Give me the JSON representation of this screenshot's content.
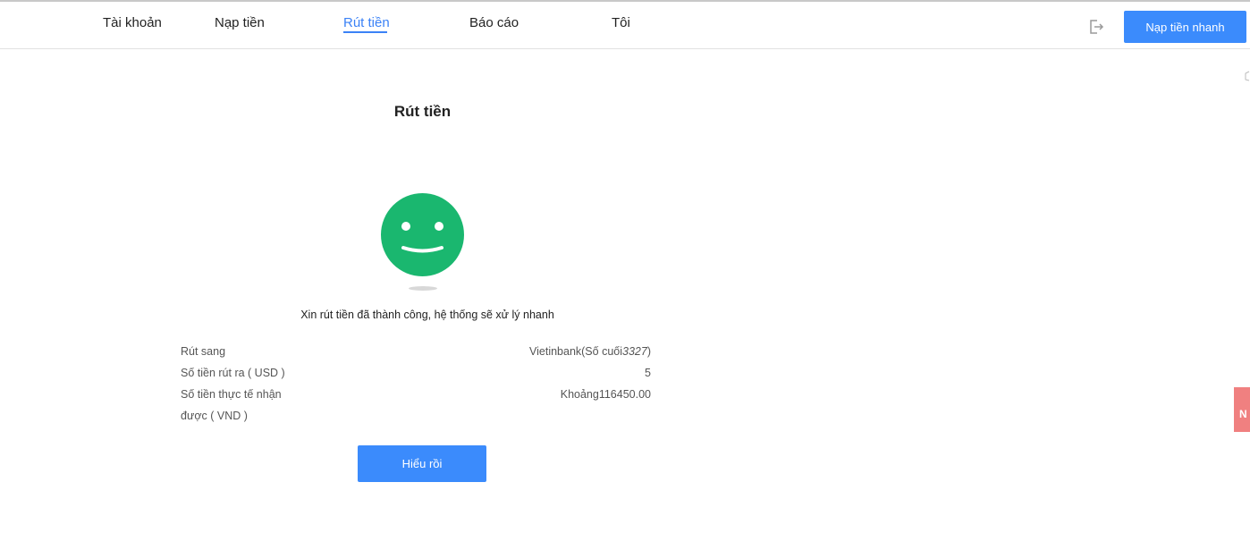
{
  "nav": {
    "items": [
      {
        "label": "Tài khoản"
      },
      {
        "label": "Nạp tiền"
      },
      {
        "label": "Rút tiền",
        "active": true
      },
      {
        "label": "Báo cáo"
      },
      {
        "label": "Tôi"
      }
    ],
    "logout_icon": "logout-icon",
    "quick_deposit_label": "Nạp tiền nhanh"
  },
  "page": {
    "title": "Rút tiền",
    "status_icon": "smiley-face-icon",
    "success_message": "Xin rút tiền đã thành công, hệ thống sẽ xử lý nhanh",
    "details": {
      "withdraw_to_label": "Rút sang",
      "withdraw_to_bank": "Vietinbank(Số cuối",
      "withdraw_to_last_digits": "3327",
      "withdraw_to_close": ")",
      "amount_label": "Số tiền rút ra ( USD )",
      "amount_value": "5",
      "received_label_line1": "Số tiền thực tế nhận",
      "received_label_line2": "được ( VND )",
      "received_value": "Khoảng116450.00"
    },
    "ok_button_label": "Hiểu rồi"
  },
  "side_tab": {
    "text": "N"
  },
  "colors": {
    "accent": "#3b8bfc",
    "success": "#1ab76f",
    "side_tab": "#f08080"
  }
}
